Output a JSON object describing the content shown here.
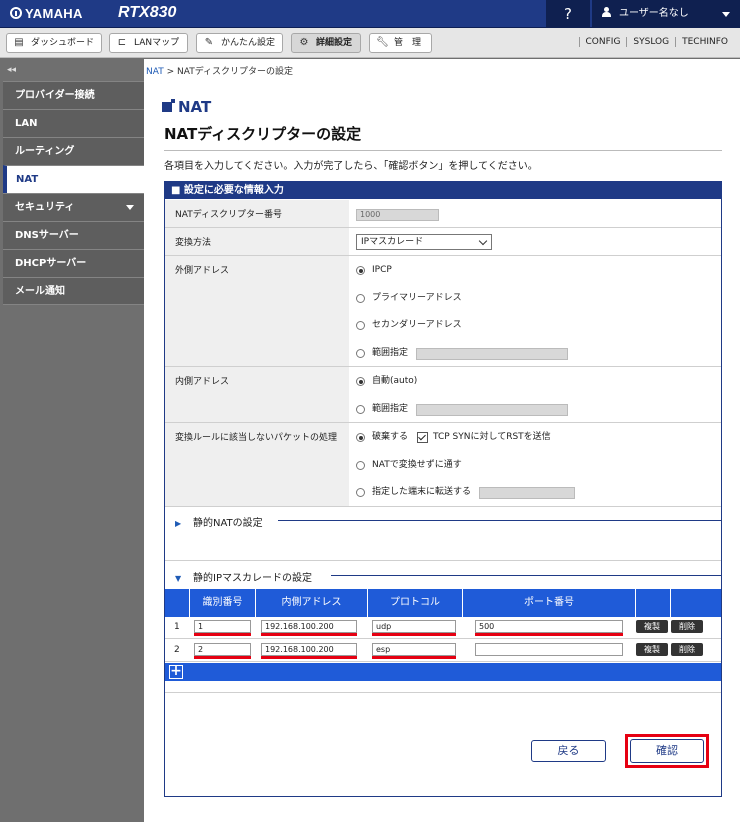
{
  "header": {
    "brand": "YAMAHA",
    "model": "RTX830",
    "help": "?",
    "user": "ユーザー名なし"
  },
  "tabs": [
    {
      "label": "ダッシュボード",
      "icon": "dashboard-icon"
    },
    {
      "label": "LANマップ",
      "icon": "lan-map-icon"
    },
    {
      "label": "かんたん設定",
      "icon": "wizard-icon"
    },
    {
      "label": "詳細設定",
      "icon": "gear-icon",
      "active": true
    },
    {
      "label": "管　理",
      "icon": "wrench-icon"
    }
  ],
  "top_links": [
    "CONFIG",
    "SYSLOG",
    "TECHINFO"
  ],
  "sidebar": {
    "collapse": "◂◂",
    "items": [
      {
        "label": "プロバイダー接続"
      },
      {
        "label": "LAN"
      },
      {
        "label": "ルーティング"
      },
      {
        "label": "NAT",
        "active": true
      },
      {
        "label": "セキュリティ",
        "has_submenu": true
      },
      {
        "label": "DNSサーバー"
      },
      {
        "label": "DHCPサーバー"
      },
      {
        "label": "メール通知"
      }
    ]
  },
  "breadcrumb": {
    "parent": "NAT",
    "sep": ">",
    "current": "NATディスクリプターの設定"
  },
  "page": {
    "section": "NAT",
    "title": "NATディスクリプターの設定",
    "instruction": "各項目を入力してください。入力が完了したら、「確認ボタン」を押してください。"
  },
  "form": {
    "panel_title": "■ 設定に必要な情報入力",
    "descriptor_label": "NATディスクリプター番号",
    "descriptor_value": "1000",
    "method_label": "変換方法",
    "method_value": "IPマスカレード",
    "outer_label": "外側アドレス",
    "outer_options": [
      "IPCP",
      "プライマリーアドレス",
      "セカンダリーアドレス",
      "範囲指定"
    ],
    "outer_selected": "IPCP",
    "inner_label": "内側アドレス",
    "inner_options": [
      "自動(auto)",
      "範囲指定"
    ],
    "inner_selected": "自動(auto)",
    "unmatched_label": "変換ルールに該当しないパケットの処理",
    "unmatched_options": [
      "破棄する",
      "NATで変換せずに通す",
      "指定した端末に転送する"
    ],
    "unmatched_selected": "破棄する",
    "rst_checkbox": "TCP SYNに対してRSTを送信",
    "rst_checked": true
  },
  "static_nat": {
    "label": "静的NATの設定",
    "expanded": false
  },
  "static_masq": {
    "label": "静的IPマスカレードの設定",
    "expanded": true,
    "columns": [
      "識別番号",
      "内側アドレス",
      "プロトコル",
      "ポート番号"
    ],
    "rows": [
      {
        "no": "1",
        "id": "1",
        "inner": "192.168.100.200",
        "protocol": "udp",
        "port": "500"
      },
      {
        "no": "2",
        "id": "2",
        "inner": "192.168.100.200",
        "protocol": "esp",
        "port": ""
      }
    ],
    "copy_label": "複製",
    "delete_label": "削除",
    "add_label": "+"
  },
  "buttons": {
    "back": "戻る",
    "confirm": "確認"
  },
  "colors": {
    "brand_blue": "#1f3a86",
    "table_blue": "#1f5bd8",
    "highlight_red": "#e60012",
    "sidebar_gray": "#6f6f6f"
  }
}
